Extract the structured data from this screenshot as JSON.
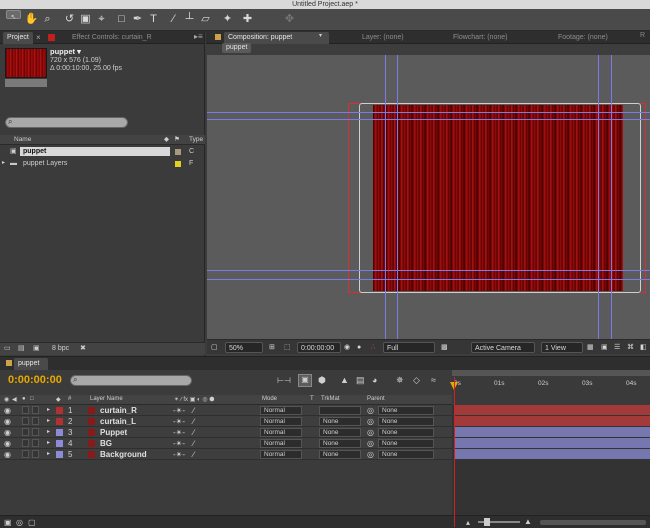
{
  "window": {
    "title": "Untitled Project.aep *"
  },
  "project_panel": {
    "tab_label": "Project",
    "effect_tab_label": "Effect Controls: curtain_R",
    "item_name": "puppet ▾",
    "item_dims": "720 x 576 (1.09)",
    "item_duration": "Δ 0:00:10:00, 25.00 fps",
    "col_name": "Name",
    "col_type": "Type",
    "items": [
      {
        "name": "puppet",
        "type": "C"
      },
      {
        "name": "puppet Layers",
        "type": "F"
      }
    ],
    "bpc_label": "8 bpc"
  },
  "comp_panel": {
    "tabs": [
      "Composition: puppet",
      "Layer: (none)",
      "Flowchart: (none)",
      "Footage: (none)"
    ],
    "breadcrumb": "puppet",
    "zoom": "50%",
    "time": "0:00:00:00",
    "resolution": "Full",
    "camera": "Active Camera",
    "views": "1 View"
  },
  "timeline": {
    "tab_label": "puppet",
    "timecode": "0:00:00:00",
    "columns": {
      "num": "#",
      "name": "Layer Name",
      "mode": "Mode",
      "t": "T",
      "trkmat": "TrkMat",
      "parent": "Parent"
    },
    "ruler_ticks": [
      "0s",
      "01s",
      "02s",
      "03s",
      "04s"
    ],
    "layers": [
      {
        "num": "1",
        "name": "curtain_R",
        "mode": "Normal",
        "trkmat": "",
        "parent": "None",
        "color": "#b33030"
      },
      {
        "num": "2",
        "name": "curtain_L",
        "mode": "Normal",
        "trkmat": "None",
        "parent": "None",
        "color": "#b33030"
      },
      {
        "num": "3",
        "name": "Puppet",
        "mode": "Normal",
        "trkmat": "None",
        "parent": "None",
        "color": "#8b8bd6"
      },
      {
        "num": "4",
        "name": "BG",
        "mode": "Normal",
        "trkmat": "None",
        "parent": "None",
        "color": "#8b8bd6"
      },
      {
        "num": "5",
        "name": "Background",
        "mode": "Normal",
        "trkmat": "None",
        "parent": "None",
        "color": "#8b8bd6"
      }
    ]
  },
  "colors": {
    "accent": "#e8a800",
    "curtain_red": "#b01010",
    "bar_red": "#a33a3a",
    "bar_blue": "#7777b0"
  }
}
